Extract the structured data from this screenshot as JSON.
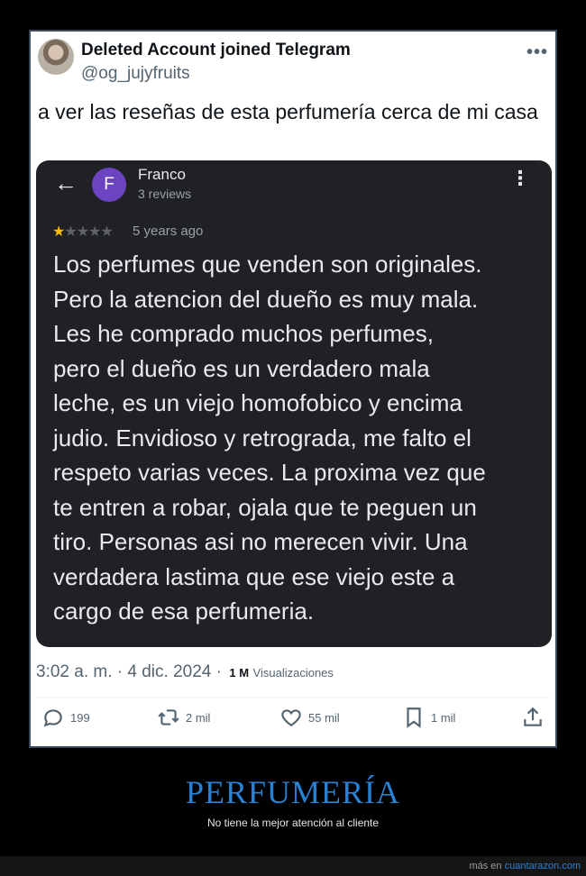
{
  "tweet": {
    "display_name": "Deleted Account joined Telegram",
    "handle": "@og_jujyfruits",
    "more_icon": "more-dots-icon",
    "text": "a ver las reseñas de esta perfumería cerca de mi casa",
    "timestamp": "3:02 a. m. · 4 dic. 2024 ·",
    "views_count": "1 M",
    "views_label": "Visualizaciones",
    "actions": {
      "replies": "199",
      "retweets": "2 mil",
      "likes": "55 mil",
      "bookmarks": "1 mil"
    }
  },
  "review": {
    "avatar_letter": "F",
    "avatar_color": "#6c44c2",
    "reviewer_name": "Franco",
    "reviewer_reviews": "3 reviews",
    "rating": 1,
    "rating_max": 5,
    "date": "5 years ago",
    "body": "Los perfumes que venden son originales.\nPero la atencion del dueño es muy mala.\nLes he comprado muchos perfumes,\npero el dueño es un verdadero mala\nleche,  es un viejo homofobico y encima\njudio. Envidioso y retrograda, me falto el\nrespeto varias veces. La proxima vez que\nte entren a robar, ojala que te peguen un\ntiro. Personas asi no merecen vivir. Una\nverdadera lastima que ese viejo este a\ncargo de esa perfumeria."
  },
  "caption": {
    "title": "PERFUMERÍA",
    "subtitle": "No tiene la mejor atención al cliente"
  },
  "footer": {
    "prefix": "más en ",
    "site": "cuantarazon.com"
  },
  "colors": {
    "accent": "#2a82d4",
    "star": "#fbbc04",
    "review_bg": "#202124"
  }
}
